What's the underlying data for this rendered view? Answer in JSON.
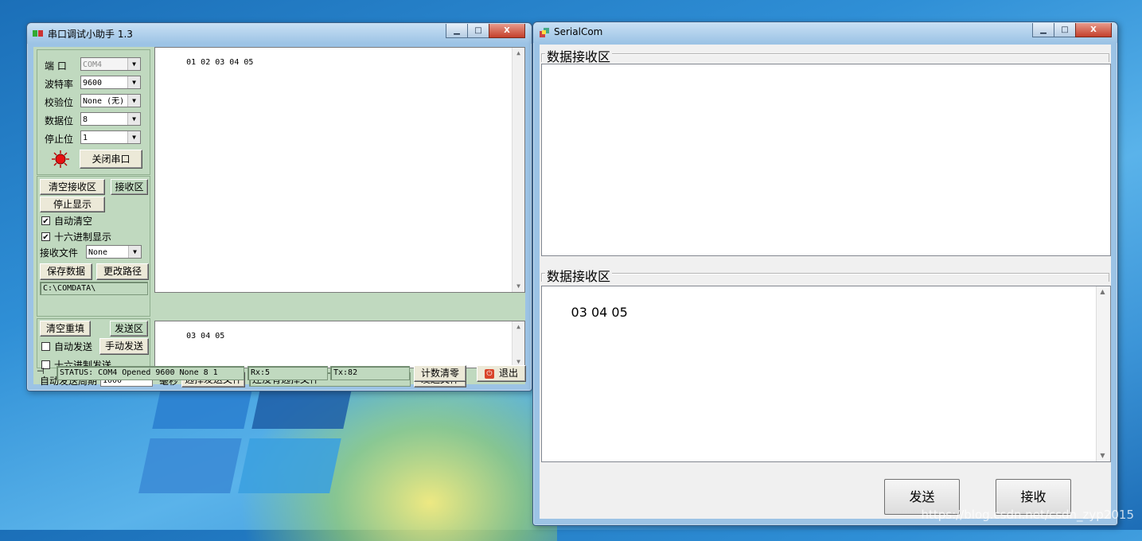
{
  "left_window": {
    "title": "串口调试小助手 1.3",
    "controls": {
      "minimize": "▁",
      "maximize": "□",
      "close": "X"
    },
    "port_settings": {
      "port_label": "端  口",
      "port_value": "COM4",
      "baud_label": "波特率",
      "baud_value": "9600",
      "parity_label": "校验位",
      "parity_value": "None (无)",
      "databits_label": "数据位",
      "databits_value": "8",
      "stopbits_label": "停止位",
      "stopbits_value": "1",
      "close_port_button": "关闭串口",
      "indicator_color": "#e81010"
    },
    "receive_options": {
      "clear_receive_button": "清空接收区",
      "receive_area_label": "接收区",
      "stop_display_button": "停止显示",
      "auto_clear_label": "自动清空",
      "auto_clear_checked": "✔",
      "hex_display_label": "十六进制显示",
      "hex_display_checked": "✔",
      "receive_file_label": "接收文件",
      "receive_file_value": "None",
      "save_data_button": "保存数据",
      "change_path_button": "更改路径",
      "path_value": "C:\\COMDATA\\"
    },
    "receive_text": "01 02 03 04 05",
    "send_options": {
      "clear_refill_button": "清空重填",
      "send_area_label": "发送区",
      "auto_send_label": "自动发送",
      "manual_send_button": "手动发送",
      "hex_send_label": "十六进制发送",
      "auto_send_period_label": "自动发送周期",
      "period_value": "1000",
      "ms_label": "毫秒",
      "choose_file_button": "选择发送文件",
      "no_file_text": "还没有选择文件",
      "send_file_button": "发送文件"
    },
    "send_text": "03 04 05",
    "status": {
      "status_text": "STATUS: COM4 Opened 9600 None  8 1",
      "rx_text": "Rx:5",
      "tx_text": "Tx:82",
      "reset_count_button": "计数清零",
      "exit_button": "退出"
    }
  },
  "right_window": {
    "title": "SerialCom",
    "controls": {
      "minimize": "▁",
      "maximize": "□",
      "close": "X"
    },
    "group1_title": "数据接收区",
    "group1_text": "",
    "group2_title": "数据接收区",
    "group2_text": "03 04 05",
    "send_button": "发送",
    "receive_button": "接收"
  },
  "watermark": "https://blog.csdn.net/csdn_zyp2015"
}
